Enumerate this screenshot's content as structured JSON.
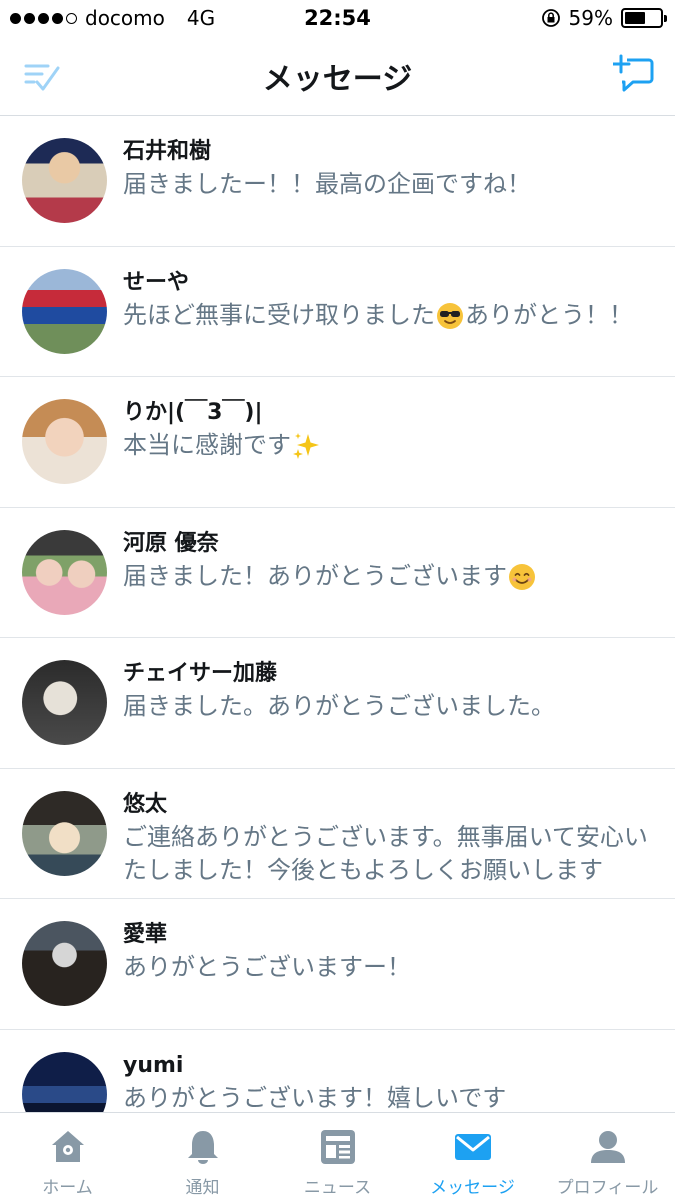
{
  "status_bar": {
    "carrier": "docomo",
    "network": "4G",
    "time": "22:54",
    "battery": "59%",
    "battery_level": 0.59
  },
  "nav": {
    "title": "メッセージ",
    "left_icon": "compose-check-icon",
    "right_icon": "new-message-icon"
  },
  "messages": [
    {
      "name": "石井和樹",
      "text": "届きましたー！！最高の企画ですね！"
    },
    {
      "name": "せーや",
      "text_before": "先ほど無事に受け取りました",
      "emoji": "sunglasses-emoji",
      "text_after": "ありがとう！！"
    },
    {
      "name": "りか|(￣3￣)|",
      "text_before": "本当に感謝です",
      "emoji": "sparkles-emoji",
      "text_after": ""
    },
    {
      "name": "河原 優奈",
      "text_before": "届きました！ありがとうございます",
      "emoji": "smile-emoji",
      "text_after": ""
    },
    {
      "name": "チェイサー加藤",
      "text": "届きました。ありがとうございました。"
    },
    {
      "name": "悠太",
      "text": "ご連絡ありがとうございます。無事届いて安心いたしました！今後ともよろしくお願いします"
    },
    {
      "name": "愛華",
      "text": "ありがとうございますー！"
    },
    {
      "name": "yumi",
      "text": "ありがとうございます！嬉しいです"
    }
  ],
  "tabs": [
    {
      "label": "ホーム",
      "icon": "home-icon"
    },
    {
      "label": "通知",
      "icon": "bell-icon"
    },
    {
      "label": "ニュース",
      "icon": "news-icon"
    },
    {
      "label": "メッセージ",
      "icon": "envelope-icon",
      "active": true
    },
    {
      "label": "プロフィール",
      "icon": "profile-icon"
    }
  ],
  "colors": {
    "accent": "#1da1f2",
    "inactive_tab": "#8899a6",
    "message_text": "#657786",
    "name_text": "#14171a"
  }
}
